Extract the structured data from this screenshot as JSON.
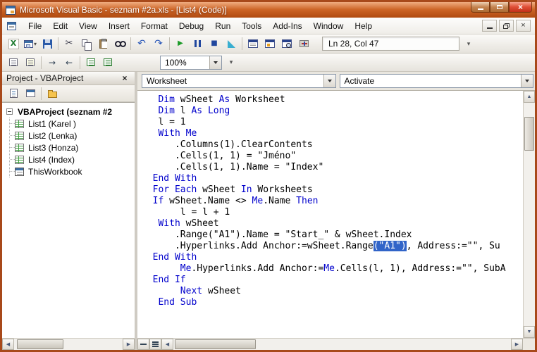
{
  "colors": {
    "frame": "#a8491a",
    "titlebar-top": "#f0ac80",
    "titlebar-mid": "#cd6527",
    "titlebar-bottom": "#b04a10",
    "keyword": "#0000cc",
    "selection-bg": "#3164c8",
    "selection-fg": "#ffffff"
  },
  "glyphs": {
    "close": "×",
    "caret": "▾",
    "scroll_up": "▲",
    "scroll_down": "▼",
    "scroll_left": "◀",
    "scroll_right": "▶"
  },
  "window": {
    "title": "Microsoft Visual Basic - seznam #2a.xls - [List4 (Code)]"
  },
  "menu": {
    "items": [
      "File",
      "Edit",
      "View",
      "Insert",
      "Format",
      "Debug",
      "Run",
      "Tools",
      "Add-Ins",
      "Window",
      "Help"
    ]
  },
  "toolbar_standard": {
    "position_display": "Ln 28, Col 47",
    "buttons": [
      {
        "name": "view-microsoft-excel",
        "icon": "excel",
        "glyph": "X"
      },
      {
        "name": "insert-userform",
        "icon": "userform",
        "caret": true
      },
      {
        "name": "save",
        "icon": "floppy"
      },
      {
        "sep": true
      },
      {
        "name": "cut",
        "icon": "cut",
        "glyph": "✂"
      },
      {
        "name": "copy",
        "icon": "copy"
      },
      {
        "name": "paste",
        "icon": "paste"
      },
      {
        "name": "find",
        "icon": "find"
      },
      {
        "sep": true
      },
      {
        "name": "undo",
        "icon": "undo",
        "glyph": "↶"
      },
      {
        "name": "redo",
        "icon": "redo",
        "glyph": "↷"
      },
      {
        "sep": true
      },
      {
        "name": "run-sub",
        "icon": "run",
        "glyph": "▶"
      },
      {
        "name": "break",
        "icon": "break"
      },
      {
        "name": "reset",
        "icon": "reset",
        "glyph": "■"
      },
      {
        "name": "design-mode",
        "icon": "design"
      },
      {
        "sep": true
      },
      {
        "name": "project-explorer",
        "icon": "winpe"
      },
      {
        "name": "properties-window",
        "icon": "winprops"
      },
      {
        "name": "object-browser",
        "icon": "winob"
      },
      {
        "name": "toolbox",
        "icon": "toolbox"
      }
    ]
  },
  "toolbar_edit": {
    "zoom_value": "100%",
    "buttons": [
      {
        "name": "list-properties",
        "icon": "lines"
      },
      {
        "name": "parameter-info",
        "icon": "lines2"
      },
      {
        "sep": true
      },
      {
        "name": "indent",
        "icon": "arrow",
        "glyph": "→"
      },
      {
        "name": "outdent",
        "icon": "arrow",
        "glyph": "←"
      },
      {
        "sep": true
      },
      {
        "name": "comment-block",
        "icon": "comment"
      },
      {
        "name": "uncomment-block",
        "icon": "comment2"
      }
    ]
  },
  "project_panel": {
    "title": "Project - VBAProject",
    "tree": {
      "root": "VBAProject (seznam #2",
      "items": [
        {
          "label": "List1 (Karel )",
          "icon": "worksheet"
        },
        {
          "label": "List2 (Lenka)",
          "icon": "worksheet"
        },
        {
          "label": "List3 (Honza)",
          "icon": "worksheet"
        },
        {
          "label": "List4 (Index)",
          "icon": "worksheet"
        },
        {
          "label": "ThisWorkbook",
          "icon": "workbook"
        }
      ]
    }
  },
  "code_window": {
    "object_box": "Worksheet",
    "procedure_box": "Activate",
    "lines": [
      [
        [
          "n",
          "   "
        ],
        [
          "k",
          "Dim"
        ],
        [
          "n",
          " wSheet "
        ],
        [
          "k",
          "As"
        ],
        [
          "n",
          " Worksheet"
        ]
      ],
      [
        [
          "n",
          "   "
        ],
        [
          "k",
          "Dim"
        ],
        [
          "n",
          " l "
        ],
        [
          "k",
          "As"
        ],
        [
          "n",
          " "
        ],
        [
          "k",
          "Long"
        ]
      ],
      [
        [
          "n",
          "   l = 1"
        ]
      ],
      [
        [
          "n",
          "   "
        ],
        [
          "k",
          "With"
        ],
        [
          "n",
          " "
        ],
        [
          "k",
          "Me"
        ]
      ],
      [
        [
          "n",
          "      .Columns(1).ClearContents"
        ]
      ],
      [
        [
          "n",
          "      .Cells(1, 1) = \"Jméno\""
        ]
      ],
      [
        [
          "n",
          "      .Cells(1, 1).Name = \"Index\""
        ]
      ],
      [
        [
          "n",
          "  "
        ],
        [
          "k",
          "End With"
        ]
      ],
      [
        [
          "n",
          "  "
        ],
        [
          "k",
          "For Each"
        ],
        [
          "n",
          " wSheet "
        ],
        [
          "k",
          "In"
        ],
        [
          "n",
          " Worksheets"
        ]
      ],
      [
        [
          "n",
          "  "
        ],
        [
          "k",
          "If"
        ],
        [
          "n",
          " wSheet.Name <> "
        ],
        [
          "k",
          "Me"
        ],
        [
          "n",
          ".Name "
        ],
        [
          "k",
          "Then"
        ]
      ],
      [
        [
          "n",
          "       l = l + 1"
        ]
      ],
      [
        [
          "n",
          "   "
        ],
        [
          "k",
          "With"
        ],
        [
          "n",
          " wSheet"
        ]
      ],
      [
        [
          "n",
          "      .Range(\"A1\").Name = \"Start_\" & wSheet.Index"
        ]
      ],
      [
        [
          "n",
          "      .Hyperlinks.Add Anchor:=wSheet.Range"
        ],
        [
          "s",
          "(\"A1\")"
        ],
        [
          "n",
          ", Address:=\"\", Su"
        ]
      ],
      [
        [
          "n",
          "  "
        ],
        [
          "k",
          "End With"
        ]
      ],
      [
        [
          "n",
          "       "
        ],
        [
          "k",
          "Me"
        ],
        [
          "n",
          ".Hyperlinks.Add Anchor:="
        ],
        [
          "k",
          "Me"
        ],
        [
          "n",
          ".Cells(l, 1), Address:=\"\", SubA"
        ]
      ],
      [
        [
          "n",
          "  "
        ],
        [
          "k",
          "End If"
        ]
      ],
      [
        [
          "n",
          "       "
        ],
        [
          "k",
          "Next"
        ],
        [
          "n",
          " wSheet"
        ]
      ],
      [
        [
          "n",
          "   "
        ],
        [
          "k",
          "End Sub"
        ]
      ]
    ]
  }
}
